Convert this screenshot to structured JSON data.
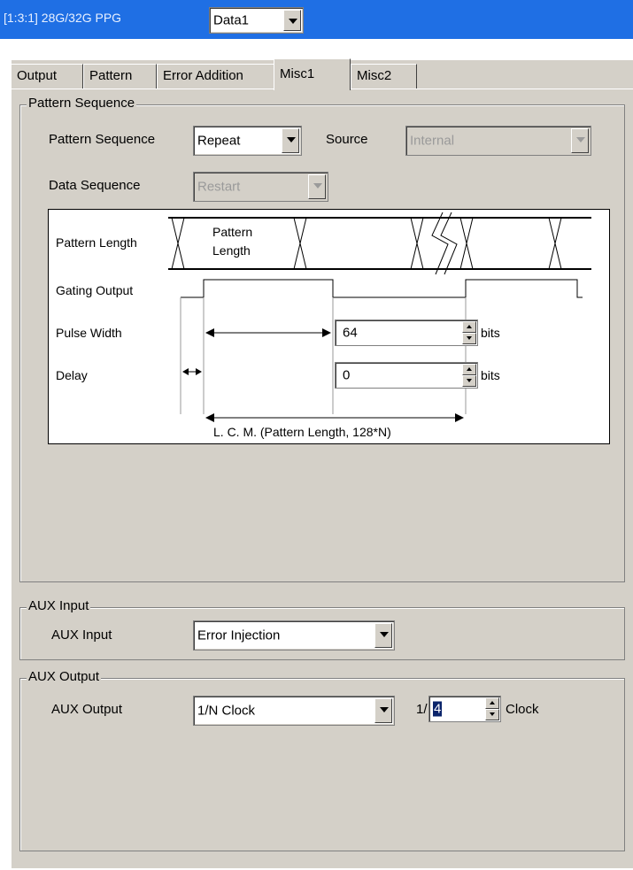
{
  "title_bar": {
    "text": "[1:3:1] 28G/32G PPG",
    "data_select": "Data1"
  },
  "tabs": [
    {
      "label": "Output",
      "active": false
    },
    {
      "label": "Pattern",
      "active": false
    },
    {
      "label": "Error Addition",
      "active": false
    },
    {
      "label": "Misc1",
      "active": true
    },
    {
      "label": "Misc2",
      "active": false
    }
  ],
  "pattern_sequence_group": {
    "title": "Pattern Sequence",
    "pattern_sequence_label": "Pattern Sequence",
    "pattern_sequence_value": "Repeat",
    "source_label": "Source",
    "source_value": "Internal",
    "data_sequence_label": "Data Sequence",
    "data_sequence_value": "Restart"
  },
  "diagram": {
    "pattern_length_label": "Pattern Length",
    "pattern_length_inner_line1": "Pattern",
    "pattern_length_inner_line2": "Length",
    "gating_output_label": "Gating Output",
    "pulse_width_label": "Pulse Width",
    "pulse_width_value": "64",
    "pulse_width_unit": "bits",
    "delay_label": "Delay",
    "delay_value": "0",
    "delay_unit": "bits",
    "lcm_label": "L. C. M. (Pattern Length, 128*N)"
  },
  "aux_input_group": {
    "title": "AUX Input",
    "label": "AUX Input",
    "value": "Error Injection"
  },
  "aux_output_group": {
    "title": "AUX Output",
    "label": "AUX Output",
    "value": "1/N Clock",
    "divider_prefix": "1/",
    "divider_value": "4",
    "divider_suffix": "Clock"
  },
  "colors": {
    "title_bar": "#1f6fe4",
    "panel": "#d4d0c8",
    "selection": "#0a246a"
  },
  "icons": [
    "dropdown-arrow-icon",
    "spin-up-icon",
    "spin-down-icon"
  ]
}
